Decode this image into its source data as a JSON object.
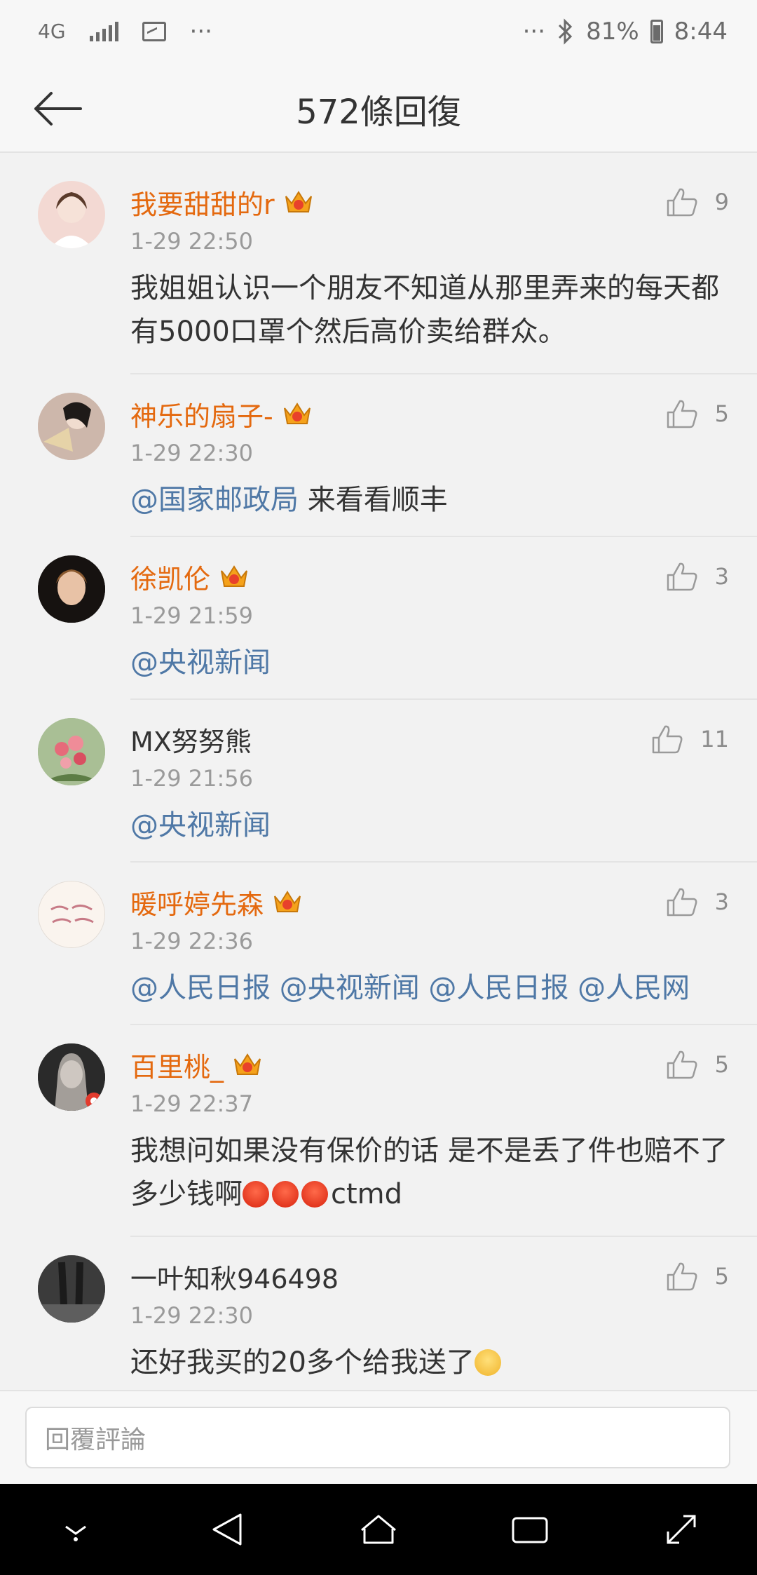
{
  "status_bar": {
    "network": "4G",
    "more": "···",
    "more_right": "···",
    "battery": "81%",
    "time": "8:44"
  },
  "header": {
    "title": "572條回復"
  },
  "comments": [
    {
      "name": "我要甜甜的r",
      "vip": true,
      "time": "1-29 22:50",
      "likes": "9",
      "text": "我姐姐认识一个朋友不知道从那里弄来的每天都有5000口罩个然后高价卖给群众。",
      "avatar_color": "#f3d9d3"
    },
    {
      "name": "神乐的扇子-",
      "vip": true,
      "time": "1-29 22:30",
      "likes": "5",
      "mention": "@国家邮政局",
      "text": " 来看看顺丰",
      "avatar_color": "#7a4b3a"
    },
    {
      "name": "徐凯伦",
      "vip": true,
      "time": "1-29 21:59",
      "likes": "3",
      "mention": "@央视新闻",
      "avatar_color": "#2b2420"
    },
    {
      "name": "MX努努熊",
      "vip": false,
      "time": "1-29 21:56",
      "likes": "11",
      "mention": "@央视新闻",
      "avatar_color": "#9fb58a"
    },
    {
      "name": "暖呼婷先森",
      "vip": true,
      "time": "1-29 22:36",
      "likes": "3",
      "mention": "@人民日报 @央视新闻 @人民日报 @人民网",
      "avatar_color": "#f6efe9"
    },
    {
      "name": "百里桃_",
      "vip": true,
      "time": "1-29 22:37",
      "likes": "5",
      "text": "我想问如果没有保价的话 是不是丢了件也赔不了多少钱啊",
      "text_tail": "ctmd",
      "avatar_color": "#3a3a3a"
    },
    {
      "name": "一叶知秋946498",
      "vip": false,
      "time": "1-29 22:30",
      "likes": "5",
      "text": "还好我买的20多个给我送了",
      "avatar_color": "#4a4a4a"
    }
  ],
  "input": {
    "placeholder": "回覆評論"
  },
  "colors": {
    "vip_name": "#e4690f",
    "mention": "#4f78a6",
    "background": "#f2f2f2"
  }
}
